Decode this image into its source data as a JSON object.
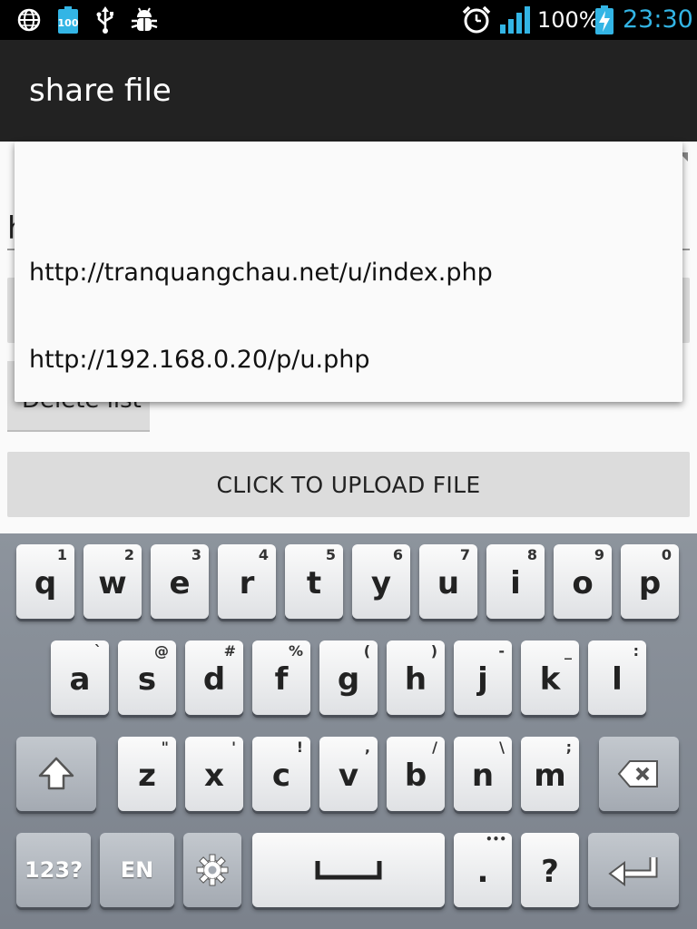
{
  "status_bar": {
    "battery_percent": "100%",
    "time": "23:30",
    "battery_small_label": "100",
    "icons": [
      "globe-icon",
      "battery-small-icon",
      "usb-icon",
      "debug-bug-icon",
      "alarm-icon",
      "signal-icon",
      "battery-charging-icon"
    ],
    "time_color": "#33b5e5"
  },
  "app": {
    "title": "share file"
  },
  "form": {
    "url_field_value": "h",
    "delete_label": "Delete list",
    "upload_label": "CLICK TO UPLOAD FILE"
  },
  "dropdown": {
    "items": [
      {
        "label": ""
      },
      {
        "label": "http://tranquangchau.net/u/index.php"
      },
      {
        "label": "http://192.168.0.20/p/u.php"
      }
    ]
  },
  "keyboard": {
    "row1": [
      {
        "key": "q",
        "sub": "1"
      },
      {
        "key": "w",
        "sub": "2"
      },
      {
        "key": "e",
        "sub": "3"
      },
      {
        "key": "r",
        "sub": "4"
      },
      {
        "key": "t",
        "sub": "5"
      },
      {
        "key": "y",
        "sub": "6"
      },
      {
        "key": "u",
        "sub": "7"
      },
      {
        "key": "i",
        "sub": "8"
      },
      {
        "key": "o",
        "sub": "9"
      },
      {
        "key": "p",
        "sub": "0"
      }
    ],
    "row2": [
      {
        "key": "a",
        "sub": "`"
      },
      {
        "key": "s",
        "sub": "@"
      },
      {
        "key": "d",
        "sub": "#"
      },
      {
        "key": "f",
        "sub": "%"
      },
      {
        "key": "g",
        "sub": "("
      },
      {
        "key": "h",
        "sub": ")"
      },
      {
        "key": "j",
        "sub": "-"
      },
      {
        "key": "k",
        "sub": "_"
      },
      {
        "key": "l",
        "sub": ":"
      }
    ],
    "row3": [
      {
        "key": "z",
        "sub": "\""
      },
      {
        "key": "x",
        "sub": "'"
      },
      {
        "key": "c",
        "sub": "!"
      },
      {
        "key": "v",
        "sub": ","
      },
      {
        "key": "b",
        "sub": "/"
      },
      {
        "key": "n",
        "sub": "\\"
      },
      {
        "key": "m",
        "sub": ";"
      }
    ],
    "symbols_label": "123?",
    "language_label": "EN",
    "period_label": ".",
    "question_label": "?",
    "more_label": "•••"
  }
}
